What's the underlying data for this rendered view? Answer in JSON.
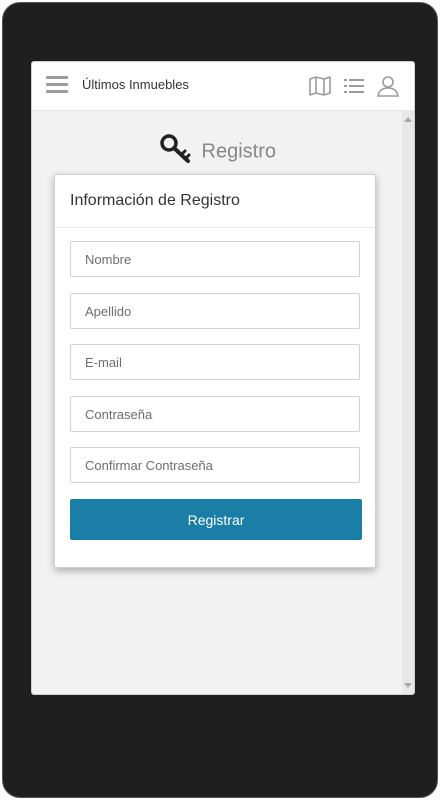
{
  "header": {
    "title": "Últimos Inmuebles",
    "icons": [
      "menu-icon",
      "map-icon",
      "list-icon",
      "user-icon"
    ]
  },
  "page": {
    "heading": "Registro",
    "heading_icon": "key-icon"
  },
  "form": {
    "title": "Información de Registro",
    "fields": {
      "nombre": {
        "placeholder": "Nombre",
        "value": ""
      },
      "apellido": {
        "placeholder": "Apellido",
        "value": ""
      },
      "email": {
        "placeholder": "E-mail",
        "value": ""
      },
      "password": {
        "placeholder": "Contraseña",
        "value": ""
      },
      "confirm": {
        "placeholder": "Confirmar Contraseña",
        "value": ""
      }
    },
    "submit_label": "Registrar"
  },
  "colors": {
    "accent": "#1a7ea7",
    "frame": "#1f1f1f",
    "background": "#f2f2f2"
  }
}
